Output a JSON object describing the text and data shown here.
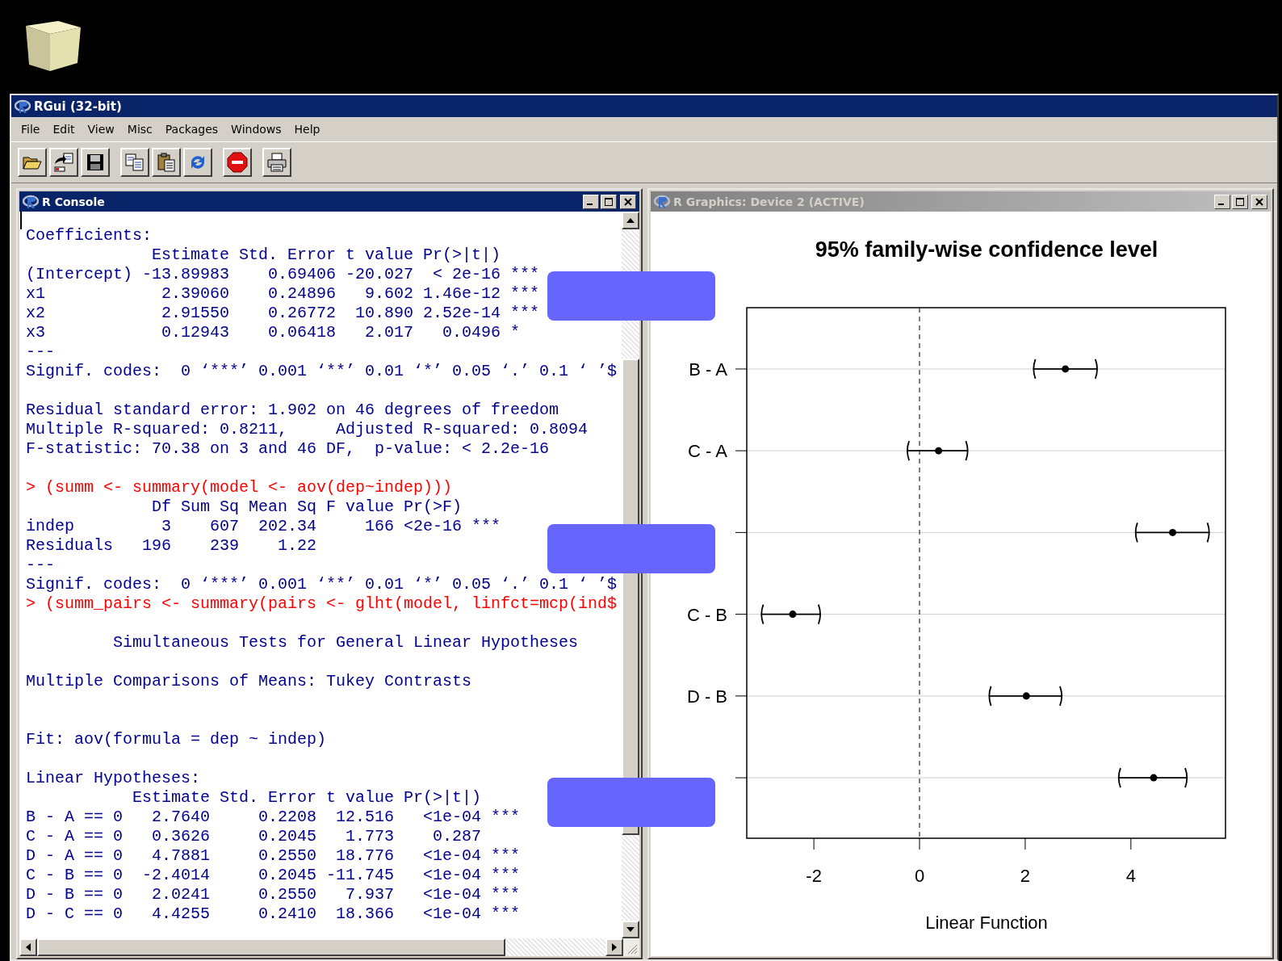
{
  "app_window": {
    "title": "RGui (32-bit)"
  },
  "menu": [
    "File",
    "Edit",
    "View",
    "Misc",
    "Packages",
    "Windows",
    "Help"
  ],
  "toolbar": [
    {
      "kind": "open"
    },
    {
      "kind": "load"
    },
    {
      "kind": "save"
    },
    {
      "kind": "copy"
    },
    {
      "kind": "paste"
    },
    {
      "kind": "refresh"
    },
    {
      "kind": "stop"
    },
    {
      "kind": "print"
    }
  ],
  "console": {
    "title": "R Console",
    "active": true,
    "lines": [
      {
        "kind": "output",
        "text": "Coefficients:"
      },
      {
        "kind": "output",
        "text": "             Estimate Std. Error t value Pr(>|t|)"
      },
      {
        "kind": "output",
        "text": "(Intercept) -13.89983    0.69406 -20.027  < 2e-16 ***"
      },
      {
        "kind": "output",
        "text": "x1            2.39060    0.24896   9.602 1.46e-12 ***"
      },
      {
        "kind": "output",
        "text": "x2            2.91550    0.26772  10.890 2.52e-14 ***"
      },
      {
        "kind": "output",
        "text": "x3            0.12943    0.06418   2.017   0.0496 *"
      },
      {
        "kind": "output",
        "text": "---"
      },
      {
        "kind": "output",
        "text": "Signif. codes:  0 ‘***’ 0.001 ‘**’ 0.01 ‘*’ 0.05 ‘.’ 0.1 ‘ ’$"
      },
      {
        "kind": "blank"
      },
      {
        "kind": "output",
        "text": "Residual standard error: 1.902 on 46 degrees of freedom"
      },
      {
        "kind": "output",
        "text": "Multiple R-squared: 0.8211,     Adjusted R-squared: 0.8094"
      },
      {
        "kind": "output",
        "text": "F-statistic: 70.38 on 3 and 46 DF,  p-value: < 2.2e-16"
      },
      {
        "kind": "blank"
      },
      {
        "kind": "input",
        "text": "> (summ <- summary(model <- aov(dep~indep)))"
      },
      {
        "kind": "output",
        "text": "             Df Sum Sq Mean Sq F value Pr(>F)"
      },
      {
        "kind": "output",
        "text": "indep         3    607  202.34     166 <2e-16 ***"
      },
      {
        "kind": "output",
        "text": "Residuals   196    239    1.22"
      },
      {
        "kind": "output",
        "text": "---"
      },
      {
        "kind": "output",
        "text": "Signif. codes:  0 ‘***’ 0.001 ‘**’ 0.01 ‘*’ 0.05 ‘.’ 0.1 ‘ ’$"
      },
      {
        "kind": "input",
        "text": "> (summ_pairs <- summary(pairs <- glht(model, linfct=mcp(ind$"
      },
      {
        "kind": "blank"
      },
      {
        "kind": "output",
        "text": "         Simultaneous Tests for General Linear Hypotheses"
      },
      {
        "kind": "blank"
      },
      {
        "kind": "output",
        "text": "Multiple Comparisons of Means: Tukey Contrasts"
      },
      {
        "kind": "blank"
      },
      {
        "kind": "blank"
      },
      {
        "kind": "output",
        "text": "Fit: aov(formula = dep ~ indep)"
      },
      {
        "kind": "blank"
      },
      {
        "kind": "output",
        "text": "Linear Hypotheses:"
      },
      {
        "kind": "output",
        "text": "           Estimate Std. Error t value Pr(>|t|)"
      },
      {
        "kind": "output",
        "text": "B - A == 0   2.7640     0.2208  12.516   <1e-04 ***"
      },
      {
        "kind": "output",
        "text": "C - A == 0   0.3626     0.2045   1.773    0.287"
      },
      {
        "kind": "output",
        "text": "D - A == 0   4.7881     0.2550  18.776   <1e-04 ***"
      },
      {
        "kind": "output",
        "text": "C - B == 0  -2.4014     0.2045 -11.745   <1e-04 ***"
      },
      {
        "kind": "output",
        "text": "D - B == 0   2.0241     0.2550   7.937   <1e-04 ***"
      },
      {
        "kind": "output",
        "text": "D - C == 0   4.4255     0.2410  18.366   <1e-04 ***"
      }
    ]
  },
  "graphics": {
    "title": "R Graphics: Device 2 (ACTIVE)",
    "active": false,
    "chart_data": {
      "type": "scatter",
      "orientation": "horizontal",
      "title": "95% family-wise confidence level",
      "xlabel": "Linear Function",
      "xlim": [
        -3.27,
        5.79
      ],
      "xticks": [
        -2,
        0,
        2,
        4
      ],
      "categories": [
        "B - A",
        "C - A",
        null,
        "C - B",
        "D - B",
        null
      ],
      "series": [
        {
          "color": "#000000",
          "values": [
            2.76,
            0.36,
            4.79,
            -2.4,
            2.02,
            4.43
          ],
          "errors": [
            [
              2.17,
              3.35
            ],
            [
              -0.22,
              0.9
            ],
            [
              4.1,
              5.47
            ],
            [
              -2.98,
              -1.89
            ],
            [
              1.33,
              2.68
            ],
            [
              3.78,
              5.05
            ]
          ]
        }
      ]
    }
  },
  "overlays": [
    {
      "kind": "panel",
      "color": "#6666ff"
    },
    {
      "kind": "panel",
      "color": "#6666ff"
    },
    {
      "kind": "panel",
      "color": "#6666ff"
    }
  ]
}
